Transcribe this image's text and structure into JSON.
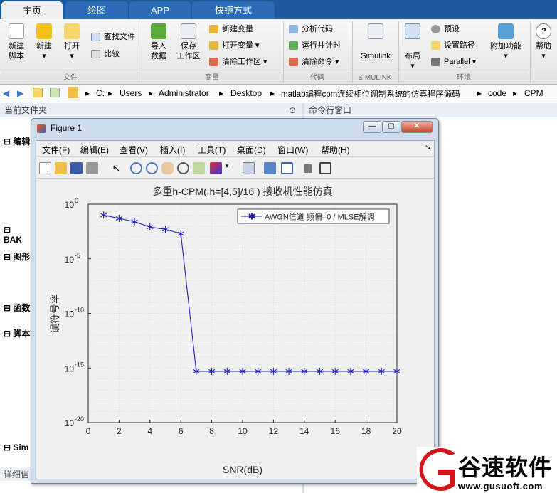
{
  "tabs": [
    {
      "label": "主页"
    },
    {
      "label": "绘图"
    },
    {
      "label": "APP"
    },
    {
      "label": "快捷方式"
    }
  ],
  "ribbon": {
    "new_script": "新建\n脚本",
    "new": "新建",
    "open": "打开",
    "find_files": "查找文件",
    "compare": "比较",
    "import": "导入\n数据",
    "save_ws": "保存\n工作区",
    "new_var": "新建变量",
    "open_var": "打开变量",
    "clear_ws": "清除工作区",
    "analyze": "分析代码",
    "run_time": "运行并计时",
    "clear_cmd": "清除命令",
    "simulink": "Simulink",
    "layout": "布局",
    "prefs": "预设",
    "set_path": "设置路径",
    "parallel": "Parallel",
    "addons": "附加功能",
    "help": "帮助",
    "groups": {
      "file": "文件",
      "var": "变量",
      "code": "代码",
      "simulink": "SIMULINK",
      "env": "环境"
    }
  },
  "address": {
    "path": [
      "C:",
      "Users",
      "Administrator",
      "Desktop",
      "matlab编程cpm连续相位调制系统的仿真程序源码",
      "code",
      "CPM"
    ]
  },
  "panels": {
    "current_folder": "当前文件夹",
    "command_window": "命令行窗口",
    "details": "详细信"
  },
  "left_sections": [
    "编辑",
    "BAK",
    "图形",
    "函数",
    "脚本",
    "Sim"
  ],
  "figure": {
    "title": "Figure 1",
    "menus": [
      "文件(F)",
      "编辑(E)",
      "查看(V)",
      "插入(I)",
      "工具(T)",
      "桌面(D)",
      "窗口(W)",
      "帮助(H)"
    ]
  },
  "chart_data": {
    "type": "line",
    "title": "多重h-CPM( h=[4,5]/16 ) 接收机性能仿真",
    "xlabel": "SNR(dB)",
    "ylabel": "误符号率",
    "yscale": "log",
    "xlim": [
      0,
      20
    ],
    "ylim": [
      1e-20,
      1
    ],
    "xticks": [
      "0",
      "2",
      "4",
      "6",
      "8",
      "10",
      "12",
      "14",
      "16",
      "18",
      "20"
    ],
    "yticks": [
      {
        "b": "10",
        "e": "0"
      },
      {
        "b": "10",
        "e": "-5"
      },
      {
        "b": "10",
        "e": "-10"
      },
      {
        "b": "10",
        "e": "-15"
      },
      {
        "b": "10",
        "e": "-20"
      }
    ],
    "grid": true,
    "legend_position": "top-right",
    "series": [
      {
        "name": "AWGN信道 频偏=0 / MLSE解调",
        "color": "#1f1fb4",
        "marker": "*",
        "x": [
          1,
          2,
          3,
          4,
          5,
          6,
          7,
          8,
          9,
          10,
          11,
          12,
          13,
          14,
          15,
          16,
          17,
          18,
          19,
          20
        ],
        "y": [
          0.1,
          0.05,
          0.025,
          0.008,
          0.005,
          0.002,
          5e-16,
          5e-16,
          5e-16,
          5e-16,
          5e-16,
          5e-16,
          5e-16,
          5e-16,
          5e-16,
          5e-16,
          5e-16,
          5e-16,
          5e-16,
          5e-16
        ]
      }
    ]
  },
  "watermark": {
    "brand": "谷速软件",
    "url": "www.gusuoft.com"
  },
  "colors": {
    "tabbar": "#1e5a9c",
    "accent": "#1f1fb4",
    "logo_red": "#d0161b"
  }
}
